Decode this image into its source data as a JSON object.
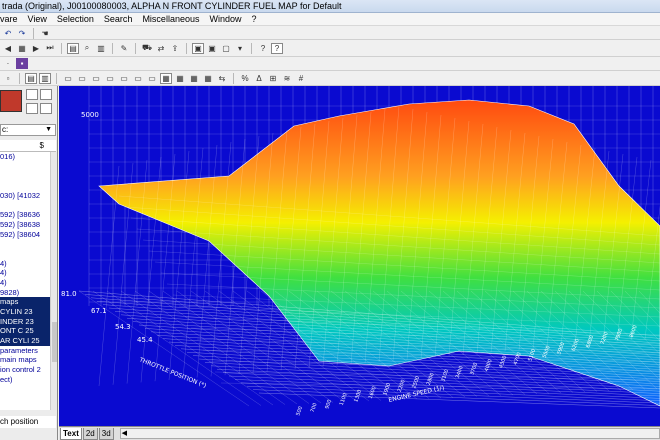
{
  "window": {
    "title": "trada (Original), J00100080003, ALPHA N FRONT CYLINDER FUEL MAP for Default"
  },
  "menu": {
    "items": [
      "vare",
      "View",
      "Selection",
      "Search",
      "Miscellaneous",
      "Window",
      "?"
    ]
  },
  "left_panel": {
    "dropdown_value": "c:",
    "header_right": "$",
    "tree_items": [
      "016)",
      "",
      "",
      "",
      "030) [41032",
      "",
      "592) [38636",
      "592) [38638",
      "592) [38604",
      "",
      "",
      "4)",
      "4)",
      "4)",
      "9828)",
      "maps",
      "CYLIN 23",
      "INDER 23",
      "ONT C 25",
      "AR CYLI 25",
      "parameters",
      "main maps",
      "ion control 2",
      "ect)",
      "",
      "",
      ""
    ],
    "footer": "ch position"
  },
  "chart3d": {
    "z_tick": "5000",
    "throttle_ticks": [
      "81.0",
      "67.1",
      "54.3",
      "45.4"
    ],
    "y_axis_title": "THROTTLE POSITION (*)",
    "x_axis_title": "ENGINE SPEED (1/)",
    "rpm_ticks": [
      "500",
      "700",
      "900",
      "1100",
      "1300",
      "1600",
      "1900",
      "2200",
      "2500",
      "2800",
      "3100",
      "3400",
      "3700",
      "4000",
      "4300",
      "4700",
      "5100",
      "5500",
      "5900",
      "6200",
      "6800",
      "7200",
      "7900",
      "8600"
    ]
  },
  "bottom_tabs": [
    "Text",
    "2d",
    "3d"
  ],
  "colors": {
    "background": "#0a0ad0",
    "surface_high": "#ff4a10",
    "surface_mid": "#f5f000",
    "surface_low": "#00d8e8",
    "mesh": "#ffffff"
  }
}
